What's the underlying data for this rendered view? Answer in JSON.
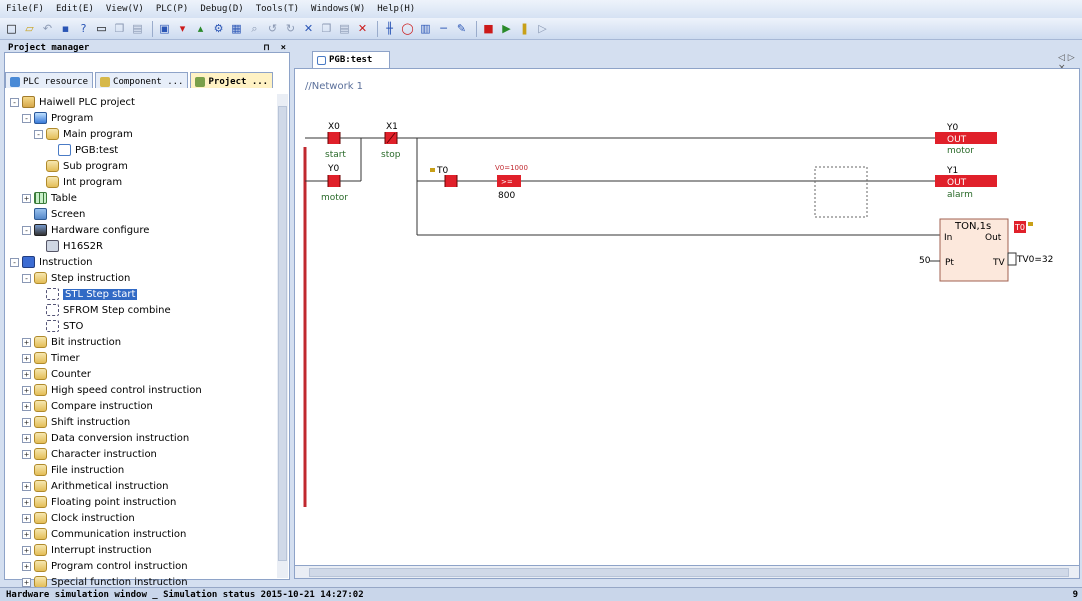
{
  "menu": [
    "File(F)",
    "Edit(E)",
    "View(V)",
    "PLC(P)",
    "Debug(D)",
    "Tools(T)",
    "Windows(W)",
    "Help(H)"
  ],
  "toolbar_icons": [
    "new-icon",
    "open-icon",
    "undo-icon",
    "save-icon",
    "help-icon",
    "print-icon",
    "copy-icon",
    "paste-icon",
    "monitor-icon",
    "download-icon",
    "upload-icon",
    "compile-icon",
    "find-icon",
    "zoom-icon",
    "undo2-icon",
    "redo2-icon",
    "cut-icon",
    "copy2-icon",
    "paste2-icon",
    "delete-icon",
    "contact-icon",
    "coil-icon",
    "box-icon",
    "line-icon",
    "trace-icon",
    "stop-icon",
    "run-icon",
    "pause-icon",
    "step-icon"
  ],
  "project_manager": {
    "title": "Project manager",
    "pin": "⊓",
    "close": "×",
    "tabs": [
      "PLC resource",
      "Component ...",
      "Project ..."
    ],
    "tree": [
      {
        "label": "Haiwell PLC project",
        "level": 0,
        "exp": "-",
        "icon": "folder"
      },
      {
        "label": "Program",
        "level": 1,
        "exp": "-",
        "icon": "prog"
      },
      {
        "label": "Main program",
        "level": 2,
        "exp": "-",
        "icon": "sub"
      },
      {
        "label": "PGB:test",
        "level": 3,
        "exp": "",
        "icon": "file"
      },
      {
        "label": "Sub program",
        "level": 2,
        "exp": "",
        "icon": "sub"
      },
      {
        "label": "Int program",
        "level": 2,
        "exp": "",
        "icon": "sub"
      },
      {
        "label": "Table",
        "level": 1,
        "exp": "+",
        "icon": "table"
      },
      {
        "label": "Screen",
        "level": 1,
        "exp": "",
        "icon": "screen"
      },
      {
        "label": "Hardware configure",
        "level": 1,
        "exp": "-",
        "icon": "hw"
      },
      {
        "label": "H16S2R",
        "level": 2,
        "exp": "",
        "icon": "chip"
      },
      {
        "label": "Instruction",
        "level": 0,
        "exp": "-",
        "icon": "instr"
      },
      {
        "label": "Step instruction",
        "level": 1,
        "exp": "-",
        "icon": "sub"
      },
      {
        "label": "STL Step start",
        "level": 2,
        "exp": "",
        "icon": "stl",
        "selected": true
      },
      {
        "label": "SFROM Step combine",
        "level": 2,
        "exp": "",
        "icon": "stl"
      },
      {
        "label": "STO",
        "level": 2,
        "exp": "",
        "icon": "stl"
      },
      {
        "label": "Bit instruction",
        "level": 1,
        "exp": "+",
        "icon": "sub"
      },
      {
        "label": "Timer",
        "level": 1,
        "exp": "+",
        "icon": "sub"
      },
      {
        "label": "Counter",
        "level": 1,
        "exp": "+",
        "icon": "sub"
      },
      {
        "label": "High speed control instruction",
        "level": 1,
        "exp": "+",
        "icon": "sub"
      },
      {
        "label": "Compare instruction",
        "level": 1,
        "exp": "+",
        "icon": "sub"
      },
      {
        "label": "Shift instruction",
        "level": 1,
        "exp": "+",
        "icon": "sub"
      },
      {
        "label": "Data conversion instruction",
        "level": 1,
        "exp": "+",
        "icon": "sub"
      },
      {
        "label": "Character instruction",
        "level": 1,
        "exp": "+",
        "icon": "sub"
      },
      {
        "label": "File instruction",
        "level": 1,
        "exp": "",
        "icon": "sub"
      },
      {
        "label": "Arithmetical instruction",
        "level": 1,
        "exp": "+",
        "icon": "sub"
      },
      {
        "label": "Floating point instruction",
        "level": 1,
        "exp": "+",
        "icon": "sub"
      },
      {
        "label": "Clock instruction",
        "level": 1,
        "exp": "+",
        "icon": "sub"
      },
      {
        "label": "Communication instruction",
        "level": 1,
        "exp": "+",
        "icon": "sub"
      },
      {
        "label": "Interrupt instruction",
        "level": 1,
        "exp": "+",
        "icon": "sub"
      },
      {
        "label": "Program control instruction",
        "level": 1,
        "exp": "+",
        "icon": "sub"
      },
      {
        "label": "Special function instruction",
        "level": 1,
        "exp": "+",
        "icon": "sub"
      }
    ]
  },
  "editor": {
    "tab_label": "PGB:test",
    "nav": "◁ ▷ ×",
    "network_label": "//Network 1",
    "contacts": {
      "x0": {
        "addr": "X0",
        "comment": "start"
      },
      "x1": {
        "addr": "X1",
        "comment": "stop"
      },
      "y0": {
        "addr": "Y0",
        "comment": "motor"
      },
      "t0": {
        "addr": "T0"
      },
      "compare": {
        "top": "V0=1000",
        "op": ">=",
        "bottom": "800"
      }
    },
    "coils": {
      "y0": {
        "addr": "Y0",
        "label": "OUT",
        "comment": "motor"
      },
      "y1": {
        "addr": "Y1",
        "label": "OUT",
        "comment": "alarm"
      }
    },
    "timer": {
      "title": "TON,1s",
      "in": "In",
      "out": "Out",
      "pt": "Pt",
      "tv": "TV",
      "pt_value": "50",
      "tv_value": "TV0=32",
      "out_addr": "T0"
    }
  },
  "status": {
    "text": "Hardware simulation window _ Simulation status 2015-10-21 14:27:02",
    "right": "9"
  },
  "colors": {
    "energized": "#e0202a",
    "rail": "#c0282f",
    "wire": "#333333"
  }
}
